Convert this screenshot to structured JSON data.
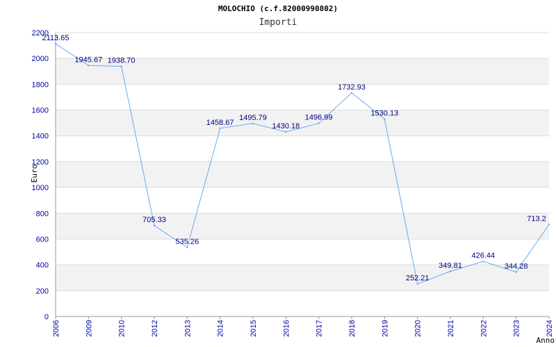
{
  "title": "MOLOCHIO (c.f.82000990802)",
  "subtitle": "Importi",
  "chart_data": {
    "type": "line",
    "title": "MOLOCHIO (c.f.82000990802)",
    "subtitle": "Importi",
    "xlabel": "Anno",
    "ylabel": "Euro",
    "categories": [
      "2006",
      "2009",
      "2010",
      "2012",
      "2013",
      "2014",
      "2015",
      "2016",
      "2017",
      "2018",
      "2019",
      "2020",
      "2021",
      "2022",
      "2023",
      "2024"
    ],
    "series": [
      {
        "values": [
          2113.65,
          1945.67,
          1938.7,
          705.33,
          535.26,
          1458.67,
          1495.79,
          1430.18,
          1496.99,
          1732.93,
          1530.13,
          252.21,
          349.81,
          426.44,
          344.28,
          713.2
        ],
        "labels": [
          "2113.65",
          "1945.67",
          "1938.70",
          "705.33",
          "535.26",
          "1458.67",
          "1495.79",
          "1430.18",
          "1496.99",
          "1732.93",
          "1530.13",
          "252.21",
          "349.81",
          "426.44",
          "344.28",
          "713.2"
        ]
      }
    ],
    "ylim": [
      0,
      2200
    ],
    "yticks": [
      "0",
      "200",
      "400",
      "600",
      "800",
      "1000",
      "1200",
      "1400",
      "1600",
      "1800",
      "2000",
      "2200"
    ],
    "grid": "horizontal alternating bands",
    "colors": {
      "line": "#66aaee",
      "band": "#f2f2f2",
      "tick_text": "#0000aa",
      "label_text": "#000080"
    }
  }
}
